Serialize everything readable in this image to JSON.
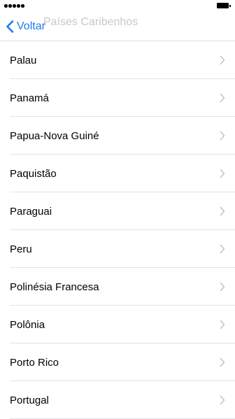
{
  "status_bar": {
    "signal_icon": "signal-dots-icon",
    "battery_icon": "battery-icon"
  },
  "nav": {
    "back_label": "Voltar",
    "back_icon": "chevron-left-icon",
    "ghost_title": "Países Caribenhos",
    "accent_color": "#1a7bf2"
  },
  "list": {
    "chevron_icon": "chevron-right-icon",
    "items": [
      {
        "label": "Palau"
      },
      {
        "label": "Panamá"
      },
      {
        "label": "Papua-Nova Guiné"
      },
      {
        "label": "Paquistão"
      },
      {
        "label": "Paraguai"
      },
      {
        "label": "Peru"
      },
      {
        "label": "Polinésia Francesa"
      },
      {
        "label": "Polônia"
      },
      {
        "label": "Porto Rico"
      },
      {
        "label": "Portugal"
      }
    ]
  }
}
